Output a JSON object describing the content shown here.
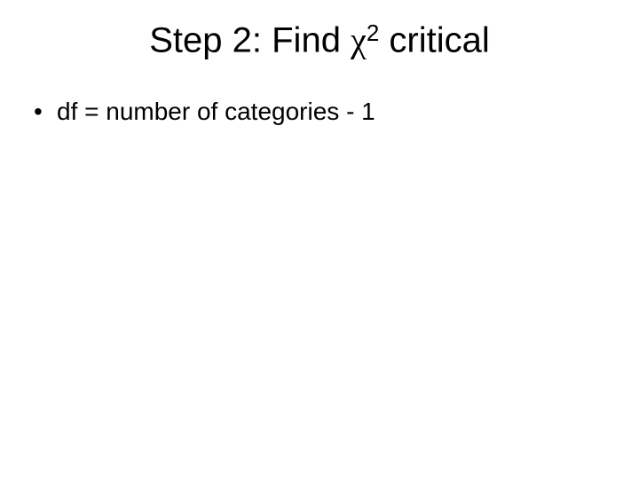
{
  "slide": {
    "title": {
      "pre": "Step 2: Find ",
      "chi": "χ",
      "super": "2",
      "post": " critical"
    },
    "bullets": [
      "df = number of categories - 1"
    ]
  }
}
